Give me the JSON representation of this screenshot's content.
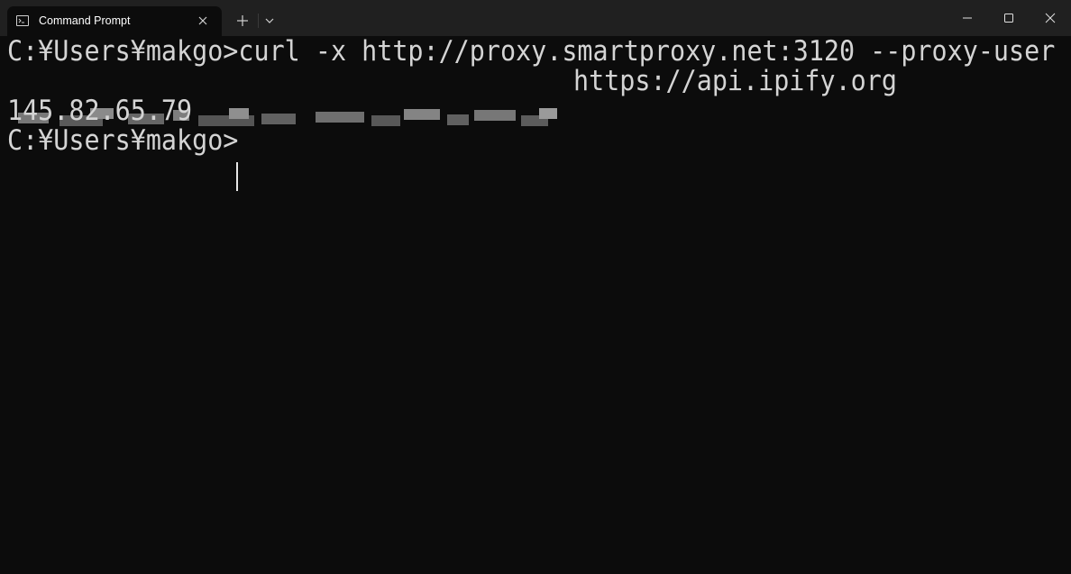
{
  "window": {
    "tab_title": "Command Prompt",
    "tab_icon": "cmd-icon",
    "buttons": {
      "close_tab": "close-icon",
      "new_tab": "plus-icon",
      "dropdown": "chevron-down-icon",
      "minimize": "minimize-icon",
      "maximize": "maximize-icon",
      "close": "close-icon"
    }
  },
  "console": {
    "lines": [
      "C:¥Users¥makgo>curl -x http://proxy.smartproxy.net:3120 --proxy-user",
      "https://api.ipify.org",
      "145.82.65.79",
      "C:¥Users¥makgo>"
    ],
    "redacted_segment": "pixelated-credentials",
    "background_color": "#0c0c0c",
    "text_color": "#d4d4d4"
  }
}
